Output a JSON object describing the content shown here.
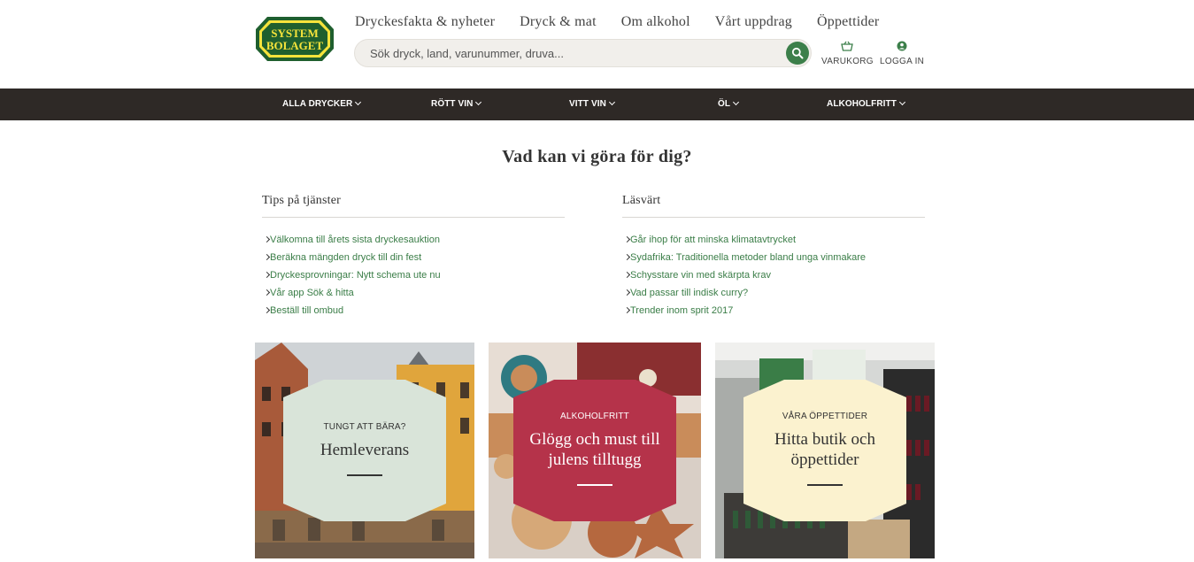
{
  "brand": {
    "logo_line1": "SYSTEM",
    "logo_line2": "BOLAGET"
  },
  "topnav": [
    "Dryckesfakta & nyheter",
    "Dryck & mat",
    "Om alkohol",
    "Vårt uppdrag",
    "Öppettider"
  ],
  "search": {
    "placeholder": "Sök dryck, land, varunummer, druva..."
  },
  "utility": {
    "cart_label": "VARUKORG",
    "login_label": "LOGGA IN"
  },
  "categories": [
    "ALLA DRYCKER",
    "RÖTT VIN",
    "VITT VIN",
    "ÖL",
    "ALKOHOLFRITT"
  ],
  "main_title": "Vad kan vi göra för dig?",
  "tips": {
    "title": "Tips på tjänster",
    "items": [
      "Välkomna till årets sista dryckesauktion",
      "Beräkna mängden dryck till din fest",
      "Dryckesprovningar: Nytt schema ute nu",
      "Vår app Sök & hitta",
      "Beställ till ombud"
    ]
  },
  "reading": {
    "title": "Läsvärt",
    "items": [
      "Går ihop för att minska klimatavtrycket",
      "Sydafrika: Traditionella metoder bland unga vinmakare",
      "Schysstare vin med skärpta krav",
      "Vad passar till indisk curry?",
      "Trender inom sprit 2017"
    ]
  },
  "cards": [
    {
      "kicker": "TUNGT ATT BÄRA?",
      "headline": "Hemleverans",
      "badge_color": "#d9e4d9",
      "text_color": "#333333"
    },
    {
      "kicker": "ALKOHOLFRITT",
      "headline": "Glögg och must till julens tilltugg",
      "badge_color": "#b5334a",
      "text_color": "#ffffff"
    },
    {
      "kicker": "VÅRA ÖPPETTIDER",
      "headline": "Hitta butik och öppettider",
      "badge_color": "#fbf2cf",
      "text_color": "#333333"
    }
  ],
  "colors": {
    "brand_green": "#3c7f4a",
    "logo_yellow": "#f5e33b",
    "catbar_bg": "#2e2926",
    "link_green": "#3a7d47"
  }
}
